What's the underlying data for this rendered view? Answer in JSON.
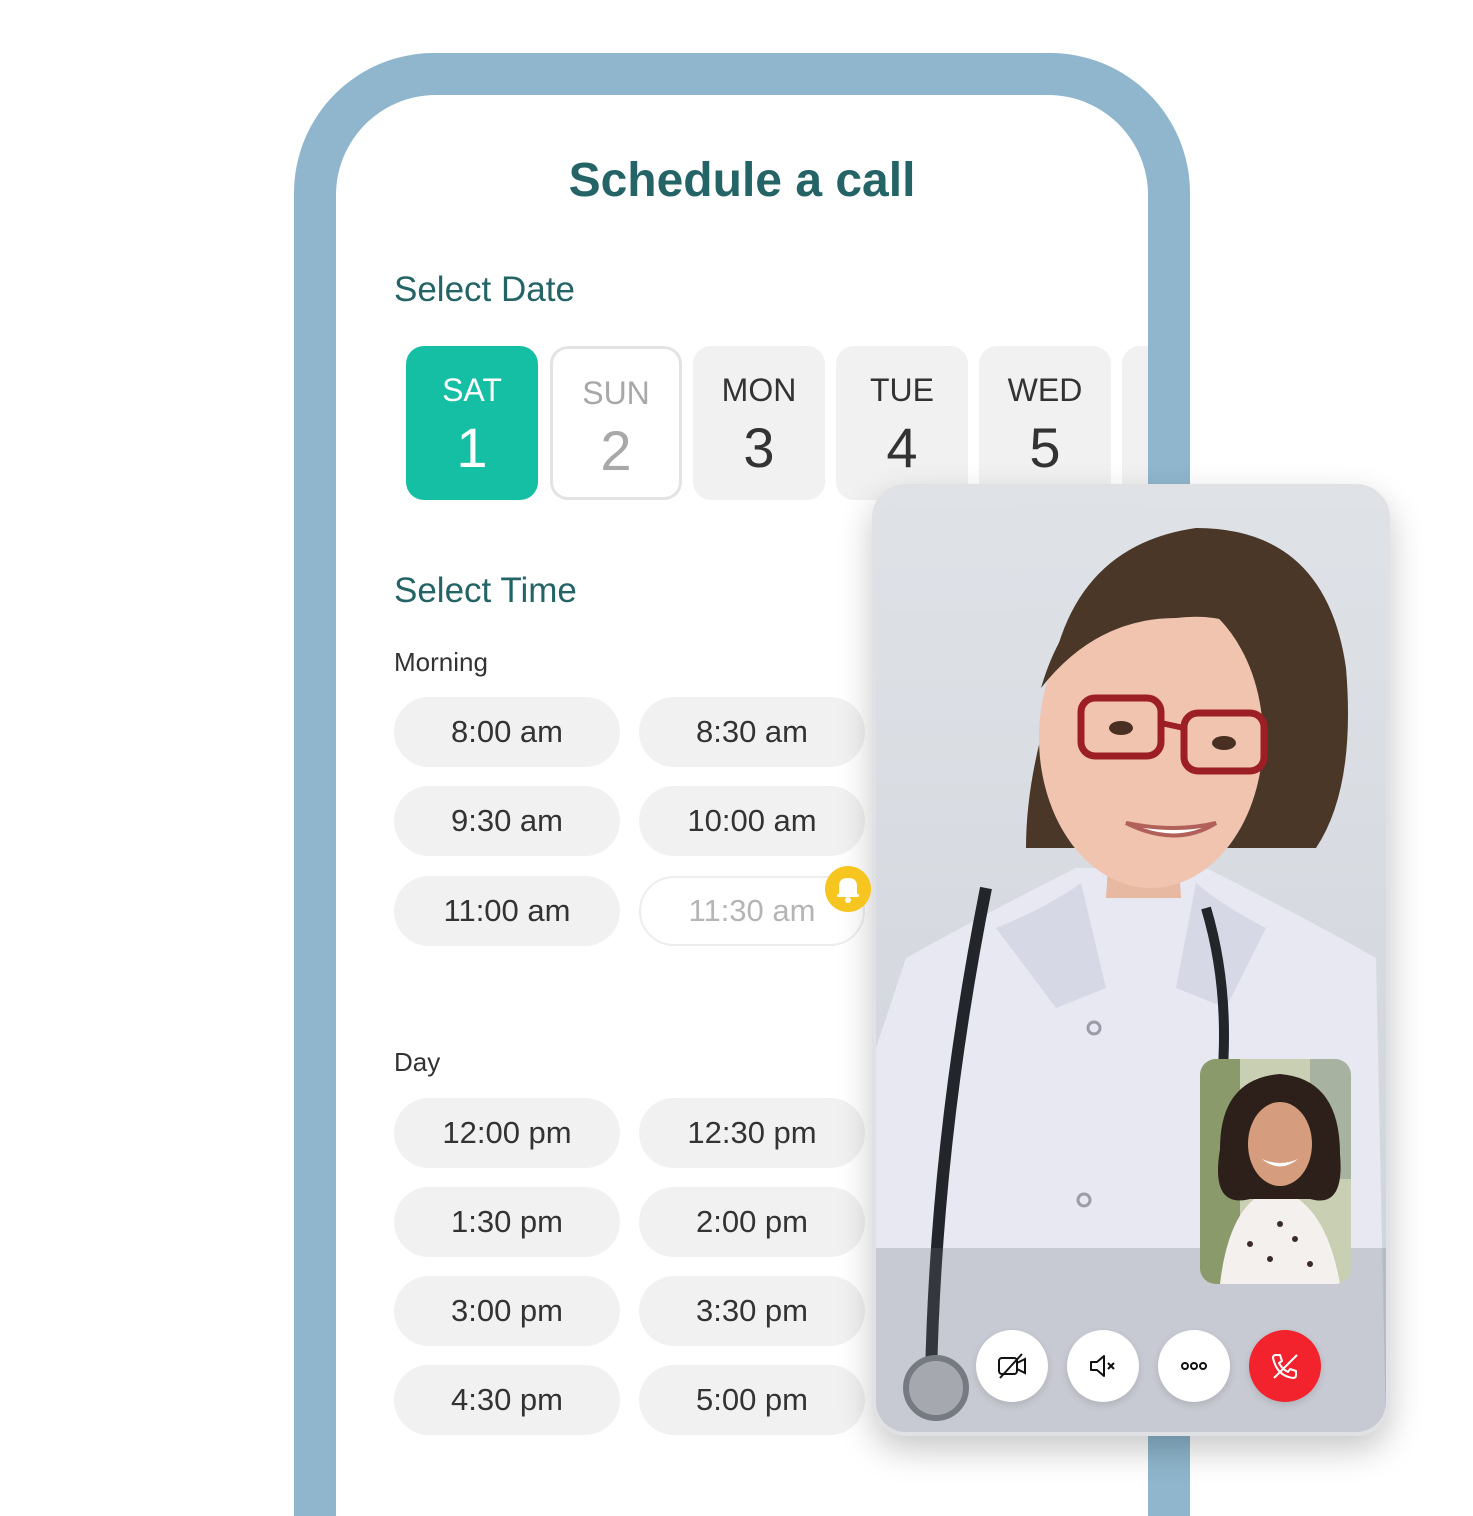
{
  "schedule": {
    "title": "Schedule a call",
    "select_date_label": "Select Date",
    "select_time_label": "Select Time",
    "dates": [
      {
        "day": "SAT",
        "num": "1",
        "state": "selected"
      },
      {
        "day": "SUN",
        "num": "2",
        "state": "disabled"
      },
      {
        "day": "MON",
        "num": "3",
        "state": "available"
      },
      {
        "day": "TUE",
        "num": "4",
        "state": "available"
      },
      {
        "day": "WED",
        "num": "5",
        "state": "available"
      }
    ],
    "morning": {
      "label": "Morning",
      "slots": [
        "8:00 am",
        "8:30 am",
        "9:30 am",
        "10:00 am",
        "11:00 am",
        "11:30 am"
      ],
      "unavailable_slot": "11:30 am"
    },
    "day": {
      "label": "Day",
      "slots": [
        "12:00 pm",
        "12:30 pm",
        "1:30 pm",
        "2:00 pm",
        "3:00 pm",
        "3:30 pm",
        "4:30 pm",
        "5:00 pm"
      ]
    }
  },
  "notification": {
    "icon": "bell-icon",
    "color": "#f7c51f"
  },
  "video_call": {
    "controls": [
      {
        "name": "camera-off-button",
        "icon": "camera-off-icon"
      },
      {
        "name": "mute-button",
        "icon": "speaker-mute-icon"
      },
      {
        "name": "more-options-button",
        "icon": "more-icon"
      },
      {
        "name": "end-call-button",
        "icon": "phone-end-icon"
      }
    ]
  },
  "colors": {
    "brand_title": "#246466",
    "selected_date": "#14bfa4",
    "frame": "#8fb6cd",
    "end_call": "#f2232d",
    "slot_bg": "#f1f1f1"
  }
}
